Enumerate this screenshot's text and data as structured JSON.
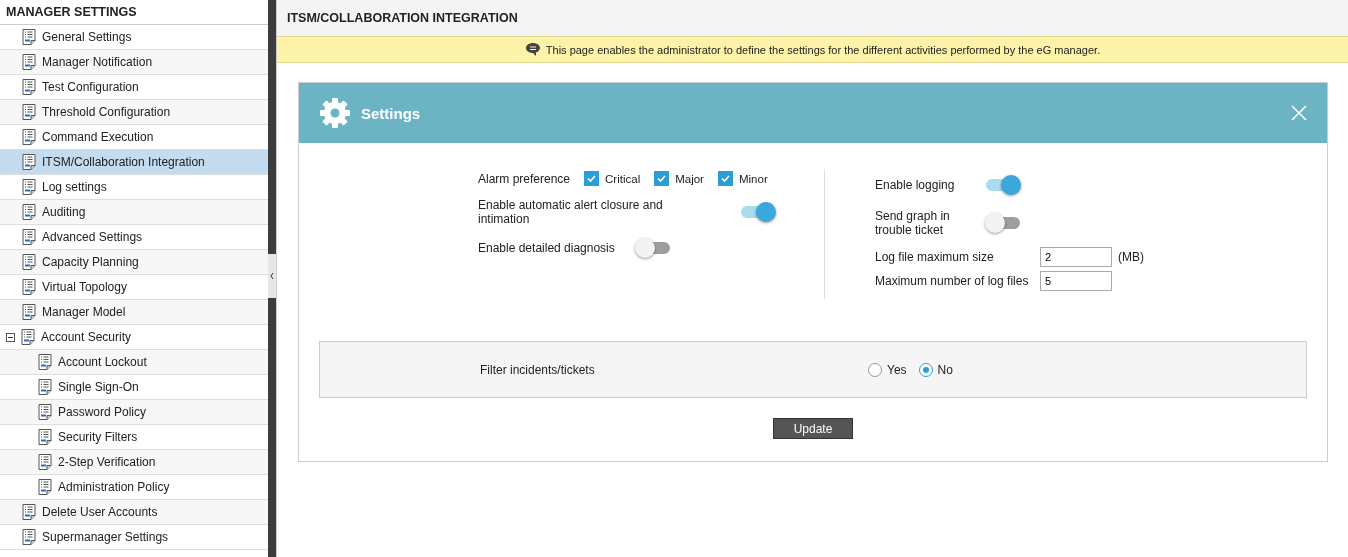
{
  "sidebar": {
    "title": "MANAGER SETTINGS",
    "items": [
      {
        "label": "General Settings",
        "selected": false
      },
      {
        "label": "Manager Notification",
        "selected": false
      },
      {
        "label": "Test Configuration",
        "selected": false
      },
      {
        "label": "Threshold Configuration",
        "selected": false
      },
      {
        "label": "Command Execution",
        "selected": false
      },
      {
        "label": "ITSM/Collaboration Integration",
        "selected": true
      },
      {
        "label": "Log settings",
        "selected": false
      },
      {
        "label": "Auditing",
        "selected": false
      },
      {
        "label": "Advanced Settings",
        "selected": false
      },
      {
        "label": "Capacity Planning",
        "selected": false
      },
      {
        "label": "Virtual Topology",
        "selected": false
      },
      {
        "label": "Manager Model",
        "selected": false
      },
      {
        "label": "Account Security",
        "selected": false,
        "expanded": true,
        "children": [
          {
            "label": "Account Lockout",
            "selected": false
          },
          {
            "label": "Single Sign-On",
            "selected": false
          },
          {
            "label": "Password Policy",
            "selected": false
          },
          {
            "label": "Security Filters",
            "selected": false
          },
          {
            "label": "2-Step Verification",
            "selected": false
          },
          {
            "label": "Administration Policy",
            "selected": false
          }
        ]
      },
      {
        "label": "Delete User Accounts",
        "selected": false
      },
      {
        "label": "Supermanager Settings",
        "selected": false
      }
    ]
  },
  "page": {
    "title": "ITSM/COLLABORATION INTEGRATION",
    "notice": "This page enables the administrator to define the settings for the different activities performed by the eG manager."
  },
  "panel": {
    "title": "Settings",
    "left": [
      {
        "kind": "checkboxes",
        "label": "Alarm preference",
        "options": [
          {
            "label": "Critical",
            "checked": true
          },
          {
            "label": "Major",
            "checked": true
          },
          {
            "label": "Minor",
            "checked": true
          }
        ]
      },
      {
        "kind": "toggle",
        "label": "Enable automatic alert closure and intimation",
        "on": true
      },
      {
        "kind": "toggle",
        "label": "Enable detailed diagnosis",
        "on": false
      }
    ],
    "right": [
      {
        "kind": "toggle",
        "label": "Enable logging",
        "on": true
      },
      {
        "kind": "toggle",
        "label": "Send graph in trouble ticket",
        "on": false
      },
      {
        "kind": "number",
        "label": "Log file maximum size",
        "value": "2",
        "unit": "(MB)"
      },
      {
        "kind": "number",
        "label": "Maximum number of log files",
        "value": "5"
      }
    ],
    "filter": {
      "label": "Filter incidents/tickets",
      "options": [
        {
          "label": "Yes",
          "selected": false
        },
        {
          "label": "No",
          "selected": true
        }
      ]
    },
    "button": "Update"
  }
}
